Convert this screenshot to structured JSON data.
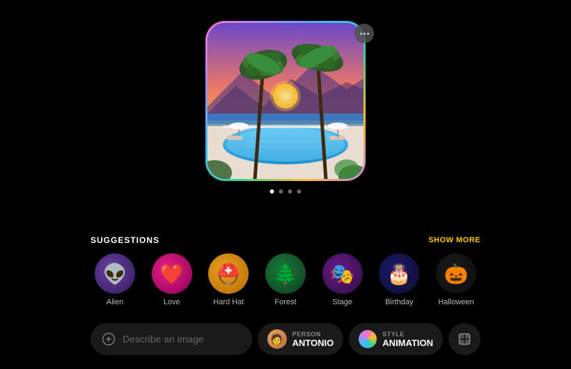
{
  "image": {
    "alt": "Pool scene at sunset with palm trees"
  },
  "more_button_label": "···",
  "dots": [
    {
      "active": true
    },
    {
      "active": false
    },
    {
      "active": false
    },
    {
      "active": false
    }
  ],
  "suggestions": {
    "title": "SUGGESTIONS",
    "show_more": "SHOW MORE",
    "items": [
      {
        "label": "Alien",
        "emoji": "👽",
        "bg_class": "icon-alien"
      },
      {
        "label": "Love",
        "emoji": "❤️",
        "bg_class": "icon-love"
      },
      {
        "label": "Hard Hat",
        "emoji": "⛑️",
        "bg_class": "icon-hardhat"
      },
      {
        "label": "Forest",
        "emoji": "🌲",
        "bg_class": "icon-forest"
      },
      {
        "label": "Stage",
        "emoji": "🎭",
        "bg_class": "icon-stage"
      },
      {
        "label": "Birthday",
        "emoji": "🎂",
        "bg_class": "icon-birthday"
      },
      {
        "label": "Halloween",
        "emoji": "🎃",
        "bg_class": "icon-halloween"
      }
    ]
  },
  "bottom_bar": {
    "describe_placeholder": "Describe an image",
    "person_type": "PERSON",
    "person_name": "ANTONIO",
    "style_type": "STYLE",
    "style_name": "ANIMATION"
  }
}
